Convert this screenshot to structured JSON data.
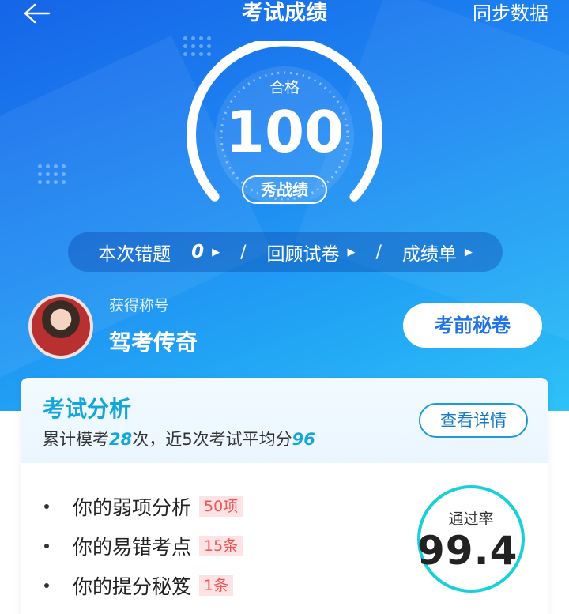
{
  "header": {
    "title": "考试成绩",
    "sync_label": "同步数据"
  },
  "score": {
    "status": "合格",
    "value": "100",
    "show_button": "秀战绩"
  },
  "summary": {
    "wrong_label": "本次错题",
    "wrong_count": "0",
    "review_label": "回顾试卷",
    "report_label": "成绩单",
    "separator": "/"
  },
  "achievement": {
    "label": "获得称号",
    "title": "驾考传奇"
  },
  "secret_button": "考前秘卷",
  "analysis": {
    "title": "考试分析",
    "sub_prefix": "累计模考",
    "mock_count": "28",
    "sub_mid": "次，近5次考试平均分",
    "avg_score": "96",
    "detail_button": "查看详情",
    "items": [
      {
        "label": "你的弱项分析",
        "badge": "50项"
      },
      {
        "label": "你的易错考点",
        "badge": "15条"
      },
      {
        "label": "你的提分秘笈",
        "badge": "1条"
      }
    ],
    "pass_rate_label": "通过率",
    "pass_rate_value": "99.4"
  },
  "colors": {
    "accent": "#14a6d8",
    "badge_text": "#f05555",
    "badge_bg": "#fde3e3",
    "ring": "#1ad0d8"
  }
}
